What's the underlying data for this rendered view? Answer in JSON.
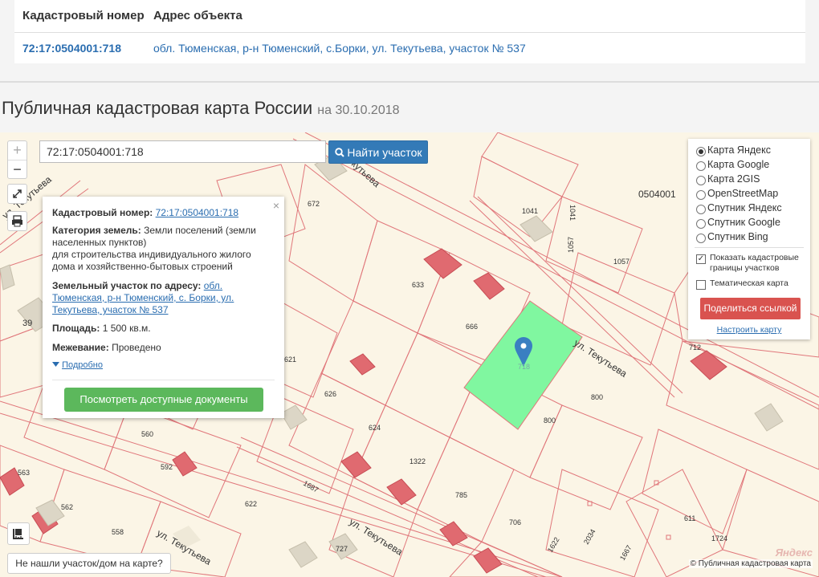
{
  "table": {
    "col_cadastral": "Кадастровый номер",
    "col_address": "Адрес объекта",
    "row_cadastral": "72:17:0504001:718",
    "row_address": "обл. Тюменская, р-н Тюменский, с.Борки, ул. Текутьева, участок № 537"
  },
  "title": {
    "main": "Публичная кадастровая карта России",
    "date": "на 30.10.2018"
  },
  "search": {
    "value": "72:17:0504001:718",
    "button": "Найти участок"
  },
  "zoom": {
    "in": "+",
    "out": "−"
  },
  "popup": {
    "close": "×",
    "cad_label": "Кадастровый номер:",
    "cad_value": "72:17:0504001:718",
    "cat_label": "Категория земель:",
    "cat_value": "Земли поселений (земли населенных пунктов)",
    "cat_use": "для строительства индивидуального жилого дома и хозяйственно-бытовых строений",
    "addr_label": "Земельный участок по адресу:",
    "addr_value": "обл. Тюменская, р-н Тюменский, с. Борки, ул. Текутьева, участок № 537",
    "area_label": "Площадь:",
    "area_value": "1 500 кв.м.",
    "survey_label": "Межевание:",
    "survey_value": "Проведено",
    "more": "Подробно",
    "docs_button": "Посмотреть доступные документы"
  },
  "layers": {
    "options": [
      "Карта Яндекс",
      "Карта Google",
      "Карта 2GIS",
      "OpenStreetMap",
      "Спутник Яндекс",
      "Спутник Google",
      "Спутник Bing"
    ],
    "selected": "Карта Яндекс",
    "show_borders": "Показать кадастровые границы участков",
    "thematic": "Тематическая карта",
    "share": "Поделиться ссылкой",
    "tune": "Настроить карту"
  },
  "not_found": "Не нашли участок/дом на карте?",
  "copyright": "© Публичная кадастровая карта",
  "yandex": "Яндекс",
  "map_labels": {
    "quarter": "0504001",
    "street1": "ул. Текутьева",
    "street2": "ул. Текутьева",
    "street3": "ул. Текутьева",
    "street4": "ул. Текутьева",
    "street5": "ул. Текутьева",
    "p718": "718",
    "p672": "672",
    "p633": "633",
    "p666": "666",
    "p1041": "1041",
    "p1057": "1057",
    "p712": "712",
    "p800a": "800",
    "p800b": "800",
    "p626": "626",
    "p624": "624",
    "p560": "560",
    "p563": "563",
    "p562": "562",
    "p592": "592",
    "p622": "622",
    "p558": "558",
    "p1322": "1322",
    "p785": "785",
    "p706": "706",
    "p727": "727",
    "p611": "611",
    "p1724": "1724",
    "p39": "39",
    "p1687": "1687",
    "p2034": "2034",
    "p1622": "1622",
    "p1667": "1667",
    "p1041v": "1041",
    "p1057v": "1057",
    "p621": "621"
  }
}
